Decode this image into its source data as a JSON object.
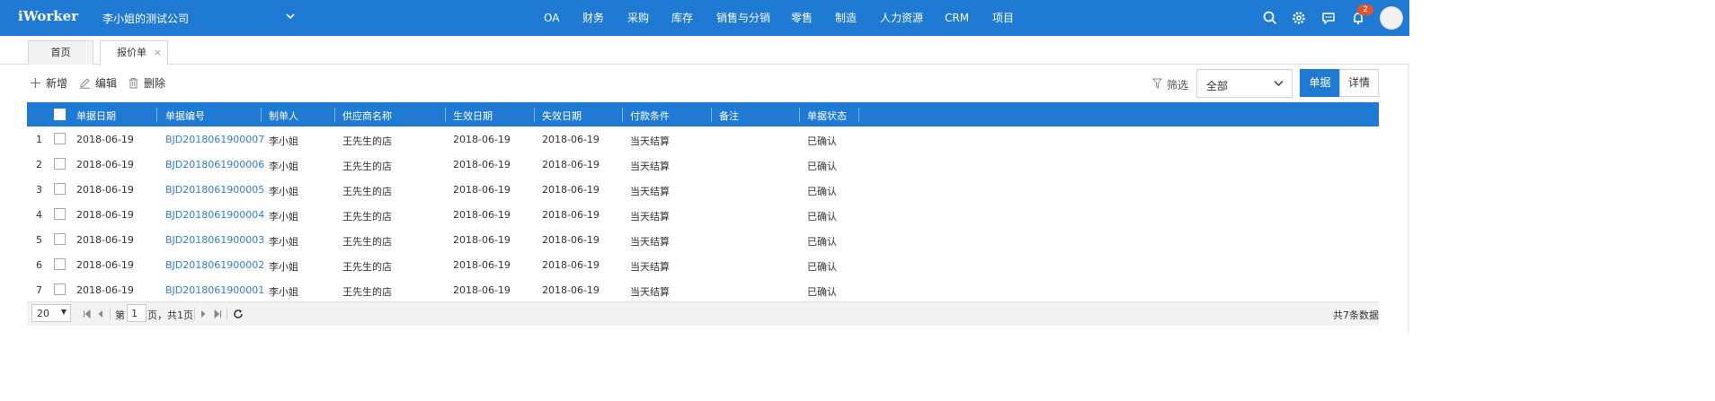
{
  "app": {
    "logo": "iWorker",
    "company": "李小姐的测试公司",
    "nav": [
      "OA",
      "财务",
      "采购",
      "库存",
      "销售与分销",
      "零售",
      "制造",
      "人力资源",
      "CRM",
      "项目"
    ],
    "notification_count": "2",
    "icons": [
      "search-icon",
      "gear-icon",
      "chat-icon",
      "bell-icon",
      "avatar"
    ]
  },
  "tabs": [
    {
      "label": "首页",
      "active": false
    },
    {
      "label": "报价单",
      "active": true,
      "close": "×"
    }
  ],
  "toolbar": {
    "add": "新增",
    "edit": "编辑",
    "delete": "删除",
    "filter_label": "筛选",
    "filter_value": "全部",
    "view_doc": "单据",
    "view_detail": "详情"
  },
  "table": {
    "columns": [
      "单据日期",
      "单据编号",
      "制单人",
      "供应商名称",
      "生效日期",
      "失效日期",
      "付款条件",
      "备注",
      "单据状态"
    ],
    "rows": [
      {
        "no": "1",
        "date": "2018-06-19",
        "code": "BJD2018061900007",
        "maker": "李小姐",
        "supplier": "王先生的店",
        "start": "2018-06-19",
        "end": "2018-06-19",
        "terms": "当天结算",
        "remark": "",
        "status": "已确认"
      },
      {
        "no": "2",
        "date": "2018-06-19",
        "code": "BJD2018061900006",
        "maker": "李小姐",
        "supplier": "王先生的店",
        "start": "2018-06-19",
        "end": "2018-06-19",
        "terms": "当天结算",
        "remark": "",
        "status": "已确认"
      },
      {
        "no": "3",
        "date": "2018-06-19",
        "code": "BJD2018061900005",
        "maker": "李小姐",
        "supplier": "王先生的店",
        "start": "2018-06-19",
        "end": "2018-06-19",
        "terms": "当天结算",
        "remark": "",
        "status": "已确认"
      },
      {
        "no": "4",
        "date": "2018-06-19",
        "code": "BJD2018061900004",
        "maker": "李小姐",
        "supplier": "王先生的店",
        "start": "2018-06-19",
        "end": "2018-06-19",
        "terms": "当天结算",
        "remark": "",
        "status": "已确认"
      },
      {
        "no": "5",
        "date": "2018-06-19",
        "code": "BJD2018061900003",
        "maker": "李小姐",
        "supplier": "王先生的店",
        "start": "2018-06-19",
        "end": "2018-06-19",
        "terms": "当天结算",
        "remark": "",
        "status": "已确认"
      },
      {
        "no": "6",
        "date": "2018-06-19",
        "code": "BJD2018061900002",
        "maker": "李小姐",
        "supplier": "王先生的店",
        "start": "2018-06-19",
        "end": "2018-06-19",
        "terms": "当天结算",
        "remark": "",
        "status": "已确认"
      },
      {
        "no": "7",
        "date": "2018-06-19",
        "code": "BJD2018061900001",
        "maker": "李小姐",
        "supplier": "王先生的店",
        "start": "2018-06-19",
        "end": "2018-06-19",
        "terms": "当天结算",
        "remark": "",
        "status": "已确认"
      }
    ]
  },
  "pager": {
    "page_size": "20",
    "page_prefix": "第",
    "page_value": "1",
    "page_suffix": "页，共1页",
    "total": "共7条数据"
  },
  "colors": {
    "brand": "#1E7AD2",
    "link": "#2F7FD3",
    "badge": "#E2522B"
  }
}
